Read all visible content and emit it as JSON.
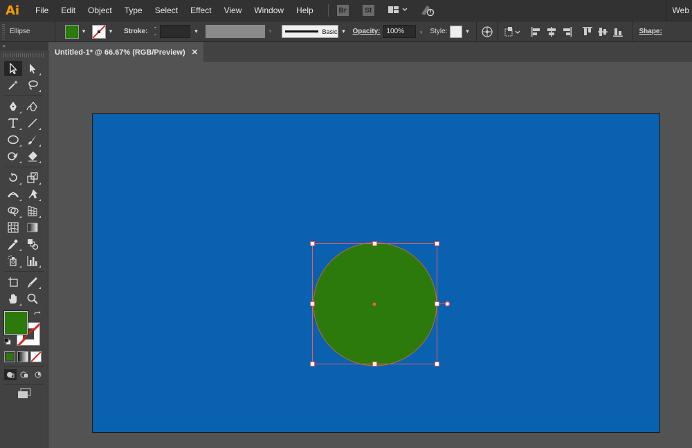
{
  "app": {
    "logo": "Ai",
    "brand_color": "#ff9a00"
  },
  "menu": [
    "File",
    "Edit",
    "Object",
    "Type",
    "Select",
    "Effect",
    "View",
    "Window",
    "Help"
  ],
  "menubar_badges": {
    "bridge": "Br",
    "stock": "St"
  },
  "workspace_label": "Web",
  "control": {
    "selection_type": "Ellipse",
    "fill_color": "#2b7a0b",
    "stroke_label": "Stroke:",
    "brush_label": "Basic",
    "opacity_label": "Opacity:",
    "opacity_value": "100%",
    "style_label": "Style:",
    "shape_label": "Shape:"
  },
  "panel_collapse": "«",
  "document": {
    "tab_title": "Untitled-1* @ 66.67% (RGB/Preview)",
    "close_glyph": "✕",
    "artboard_color": "#0a61af",
    "ellipse_fill": "#2b7a0b",
    "selection_color": "#f45a5a"
  },
  "tools_panel": {
    "fill_color": "#2b7a0b",
    "tools": [
      [
        "selection-tool",
        "direct-selection-tool"
      ],
      [
        "magic-wand-tool",
        "lasso-tool"
      ],
      [
        "pen-tool",
        "curvature-tool"
      ],
      [
        "type-tool",
        "line-segment-tool"
      ],
      [
        "ellipse-tool",
        "paintbrush-tool"
      ],
      [
        "shaper-tool",
        "eraser-tool"
      ],
      [
        "rotate-tool",
        "scale-tool"
      ],
      [
        "width-tool",
        "puppet-warp-tool"
      ],
      [
        "shape-builder-tool",
        "perspective-grid-tool"
      ],
      [
        "mesh-tool",
        "gradient-tool"
      ],
      [
        "eyedropper-tool",
        "blend-tool"
      ],
      [
        "symbol-sprayer-tool",
        "column-graph-tool"
      ],
      [
        "artboard-tool",
        "slice-tool"
      ],
      [
        "hand-tool",
        "zoom-tool"
      ]
    ]
  }
}
